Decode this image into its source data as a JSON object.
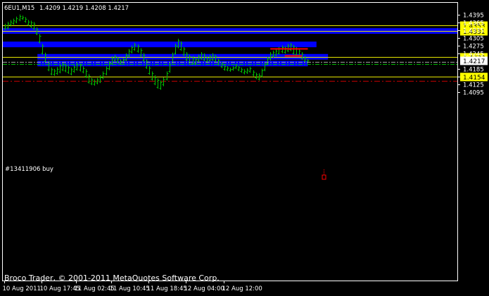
{
  "header": {
    "symbol_timeframe": "6EU1,M15",
    "ohlc": "1.4209 1.4219 1.4208 1.4217"
  },
  "footer": {
    "copyright": "Broco Trader, © 2001-2011 MetaQuotes Software Corp."
  },
  "trade": {
    "order_label": "#13411906 buy",
    "order_price": 1.4213,
    "stop_price": 1.4205,
    "order_line_color": "#a0a0a0",
    "stop_line_color": "#00c000"
  },
  "colors": {
    "background": "#000000",
    "candles": "#00c000",
    "axis": "#ffffff",
    "level_line": "#e6e600",
    "price_tag_bg": "#ffff00",
    "zone": "#0000ff",
    "stop_dash": "#c00000",
    "marker_red": "#ff0000"
  },
  "chart_data": {
    "type": "bar",
    "title": "",
    "ylim": [
      1.41,
      1.44
    ],
    "y_ticks": [
      "1.4395",
      "1.4365",
      "1.4335",
      "1.4305",
      "1.4275",
      "1.4245",
      "1.4185",
      "1.4154",
      "1.4125",
      "1.4095"
    ],
    "x_ticks": [
      "10 Aug 2011",
      "10 Aug 17:45",
      "11 Aug 02:45",
      "11 Aug 10:45",
      "11 Aug 18:45",
      "12 Aug 04:00",
      "12 Aug 12:00"
    ],
    "current_price": "1.4217",
    "levels": [
      {
        "price": 1.4353,
        "label": "1.4353",
        "style": "solid"
      },
      {
        "price": 1.4331,
        "label": "1.4331",
        "style": "solid"
      },
      {
        "price": 1.4232,
        "label": "1.4232",
        "style": "solid"
      },
      {
        "price": 1.4154,
        "label": "1.4154",
        "style": "solid"
      },
      {
        "price": 1.4139,
        "label": "",
        "style": "dashdot"
      }
    ],
    "zones": [
      {
        "price": 1.4332,
        "bar_start": 0,
        "bar_end": 162
      },
      {
        "price": 1.428,
        "bar_start": 0,
        "bar_end": 108
      },
      {
        "price": 1.4232,
        "bar_start": 12,
        "bar_end": 112
      },
      {
        "price": 1.4206,
        "bar_start": 12,
        "bar_end": 105
      }
    ],
    "red_marks": [
      {
        "price": 1.4265,
        "bar_start": 92,
        "bar_end": 105
      },
      {
        "price": 1.4236,
        "bar_start": 97,
        "bar_end": 103
      }
    ],
    "bars": [
      [
        1.436,
        1.4336
      ],
      [
        1.4368,
        1.4338
      ],
      [
        1.4375,
        1.435
      ],
      [
        1.438,
        1.4356
      ],
      [
        1.4388,
        1.4362
      ],
      [
        1.4396,
        1.437
      ],
      [
        1.4392,
        1.4375
      ],
      [
        1.4386,
        1.4364
      ],
      [
        1.4375,
        1.4352
      ],
      [
        1.4372,
        1.4344
      ],
      [
        1.4367,
        1.4336
      ],
      [
        1.4346,
        1.4316
      ],
      [
        1.432,
        1.4284
      ],
      [
        1.4282,
        1.424
      ],
      [
        1.4248,
        1.4208
      ],
      [
        1.4215,
        1.4176
      ],
      [
        1.419,
        1.416
      ],
      [
        1.4185,
        1.4158
      ],
      [
        1.4192,
        1.4162
      ],
      [
        1.4205,
        1.4168
      ],
      [
        1.421,
        1.4176
      ],
      [
        1.4206,
        1.4172
      ],
      [
        1.4198,
        1.4166
      ],
      [
        1.419,
        1.416
      ],
      [
        1.42,
        1.417
      ],
      [
        1.421,
        1.4178
      ],
      [
        1.4206,
        1.4175
      ],
      [
        1.4195,
        1.4168
      ],
      [
        1.4184,
        1.415
      ],
      [
        1.4165,
        1.4128
      ],
      [
        1.415,
        1.4122
      ],
      [
        1.4144,
        1.412
      ],
      [
        1.415,
        1.4125
      ],
      [
        1.416,
        1.413
      ],
      [
        1.4175,
        1.4145
      ],
      [
        1.4195,
        1.416
      ],
      [
        1.4215,
        1.418
      ],
      [
        1.4235,
        1.42
      ],
      [
        1.424,
        1.4212
      ],
      [
        1.4232,
        1.4206
      ],
      [
        1.4222,
        1.42
      ],
      [
        1.4228,
        1.4205
      ],
      [
        1.4245,
        1.4215
      ],
      [
        1.4262,
        1.423
      ],
      [
        1.4276,
        1.4245
      ],
      [
        1.4286,
        1.4255
      ],
      [
        1.428,
        1.4248
      ],
      [
        1.4265,
        1.4232
      ],
      [
        1.4246,
        1.4212
      ],
      [
        1.4222,
        1.4185
      ],
      [
        1.4196,
        1.4162
      ],
      [
        1.4175,
        1.414
      ],
      [
        1.416,
        1.4122
      ],
      [
        1.4148,
        1.4108
      ],
      [
        1.414,
        1.4104
      ],
      [
        1.4152,
        1.4118
      ],
      [
        1.4175,
        1.414
      ],
      [
        1.421,
        1.417
      ],
      [
        1.4248,
        1.4205
      ],
      [
        1.4283,
        1.424
      ],
      [
        1.4302,
        1.4265
      ],
      [
        1.4292,
        1.4255
      ],
      [
        1.427,
        1.4235
      ],
      [
        1.425,
        1.4215
      ],
      [
        1.424,
        1.4205
      ],
      [
        1.4235,
        1.42
      ],
      [
        1.423,
        1.42
      ],
      [
        1.424,
        1.421
      ],
      [
        1.425,
        1.422
      ],
      [
        1.4245,
        1.4215
      ],
      [
        1.4235,
        1.4208
      ],
      [
        1.424,
        1.4212
      ],
      [
        1.4246,
        1.4216
      ],
      [
        1.424,
        1.421
      ],
      [
        1.4225,
        1.4198
      ],
      [
        1.4212,
        1.4188
      ],
      [
        1.4202,
        1.4178
      ],
      [
        1.4196,
        1.4176
      ],
      [
        1.419,
        1.4174
      ],
      [
        1.4196,
        1.4178
      ],
      [
        1.4204,
        1.4184
      ],
      [
        1.4198,
        1.4176
      ],
      [
        1.419,
        1.417
      ],
      [
        1.4184,
        1.4164
      ],
      [
        1.4188,
        1.4166
      ],
      [
        1.4194,
        1.417
      ],
      [
        1.418,
        1.4156
      ],
      [
        1.417,
        1.4145
      ],
      [
        1.4168,
        1.414
      ],
      [
        1.4186,
        1.4152
      ],
      [
        1.421,
        1.4176
      ],
      [
        1.4232,
        1.42
      ],
      [
        1.425,
        1.4218
      ],
      [
        1.4256,
        1.4228
      ],
      [
        1.4262,
        1.4234
      ],
      [
        1.427,
        1.424
      ],
      [
        1.4276,
        1.4246
      ],
      [
        1.4273,
        1.4244
      ],
      [
        1.4282,
        1.425
      ],
      [
        1.4286,
        1.4254
      ],
      [
        1.4278,
        1.424
      ],
      [
        1.427,
        1.4235
      ],
      [
        1.4262,
        1.4232
      ],
      [
        1.425,
        1.422
      ],
      [
        1.4236,
        1.421
      ],
      [
        1.4224,
        1.4206
      ]
    ],
    "x_tick_bars": [
      0,
      13,
      25,
      37,
      50,
      63,
      76
    ]
  }
}
